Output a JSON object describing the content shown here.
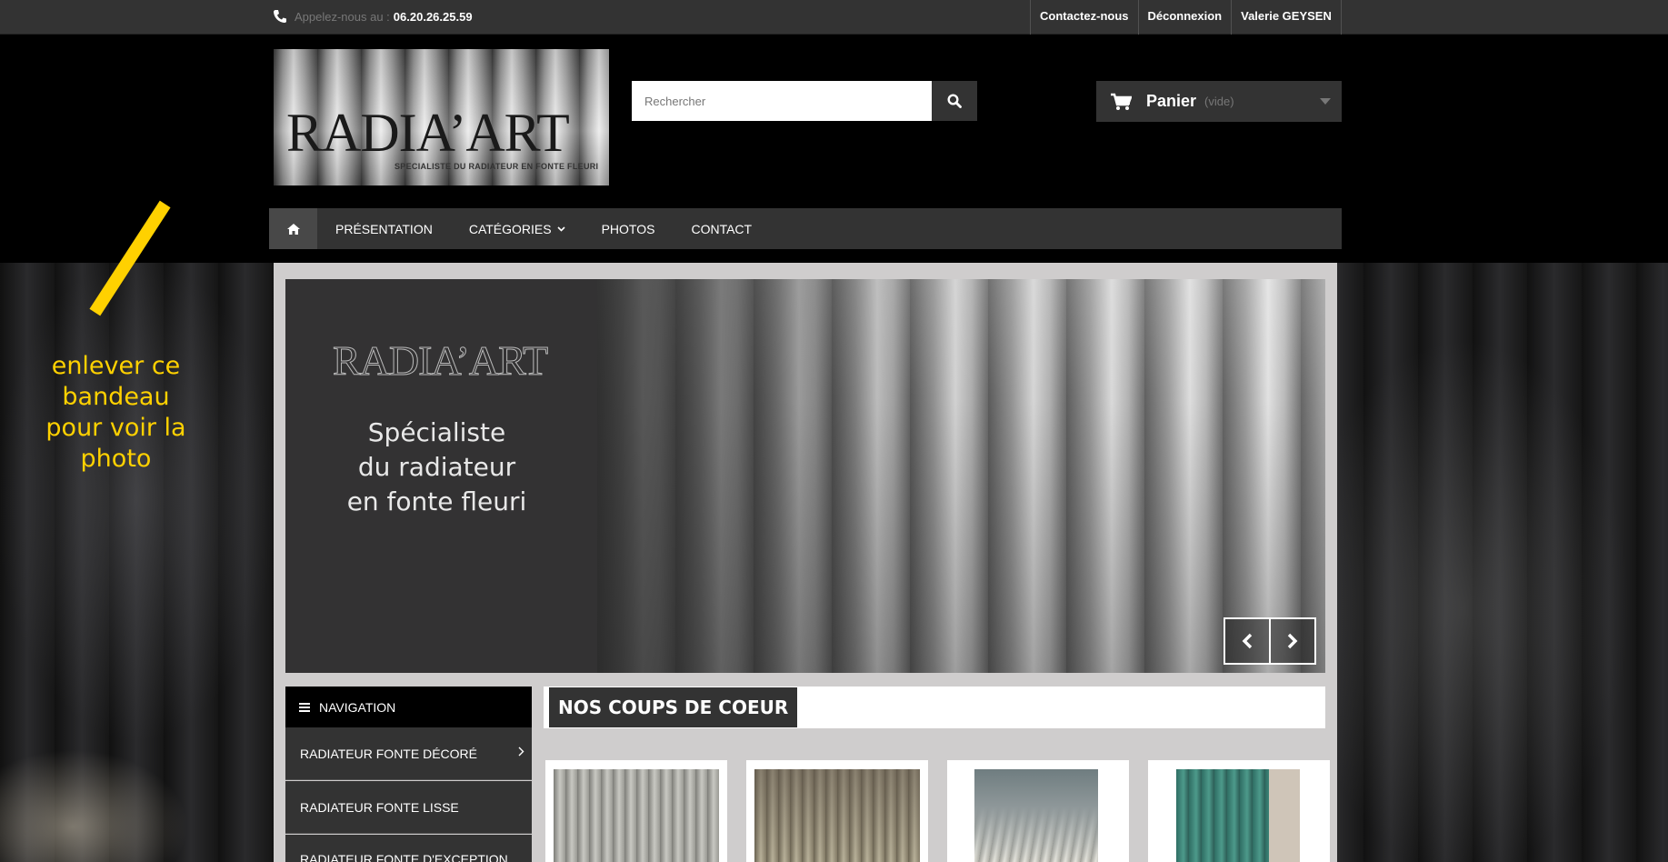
{
  "topbar": {
    "phone_prefix": "Appelez-nous au :",
    "phone_number": "06.20.26.25.59",
    "links": [
      "Contactez-nous",
      "Déconnexion",
      "Valerie GEYSEN"
    ]
  },
  "logo": {
    "title": "RADIA’ART",
    "subtitle": "SPECIALISTE DU RADIATEUR EN FONTE FLEURI"
  },
  "search": {
    "placeholder": "Rechercher"
  },
  "cart": {
    "label": "Panier",
    "status": "(vide)"
  },
  "menu": {
    "items": [
      "PRÉSENTATION",
      "CATÉGORIES",
      "PHOTOS",
      "CONTACT"
    ]
  },
  "annotation": {
    "text": "enlever ce bandeau pour voir la photo",
    "color": "#ffd100"
  },
  "slider": {
    "brand": "RADIA’ART",
    "tagline_lines": [
      "Spécialiste",
      "du radiateur",
      "en fonte fleuri"
    ]
  },
  "navigation": {
    "title": "NAVIGATION",
    "items": [
      "RADIATEUR FONTE DÉCORÉ",
      "RADIATEUR FONTE LISSE",
      "RADIATEUR FONTE D'EXCEPTION"
    ]
  },
  "section": {
    "title": "NOS COUPS DE COEUR"
  },
  "colors": {
    "dark": "#333333",
    "background": "#000000",
    "column": "#cfcdcd",
    "accent": "#ffd100"
  }
}
